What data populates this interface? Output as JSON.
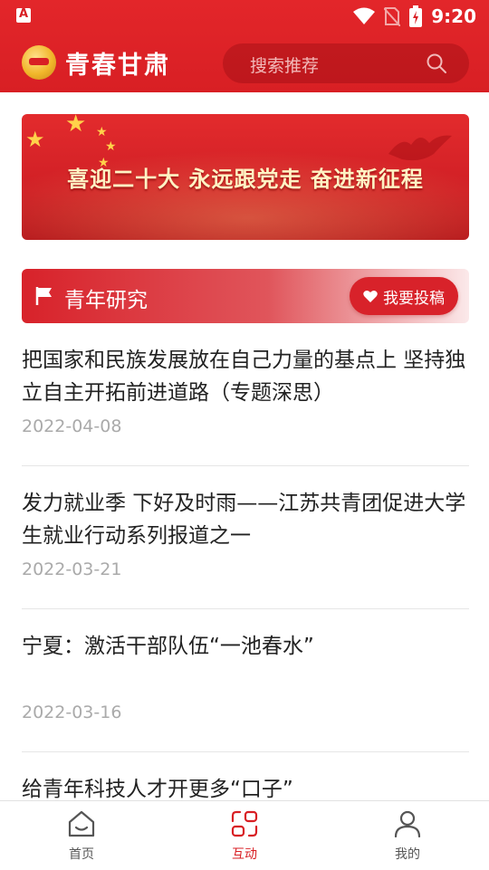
{
  "status_bar": {
    "time": "9:20"
  },
  "header": {
    "app_title": "青春甘肃",
    "search": {
      "placeholder": "搜索推荐"
    }
  },
  "banner": {
    "text": "喜迎二十大  永远跟党走  奋进新征程"
  },
  "section": {
    "title": "青年研究",
    "submit_label": "我要投稿"
  },
  "articles": [
    {
      "title": "把国家和民族发展放在自己力量的基点上 坚持独立自主开拓前进道路（专题深思）",
      "date": "2022-04-08"
    },
    {
      "title": "发力就业季 下好及时雨——江苏共青团促进大学生就业行动系列报道之一",
      "date": "2022-03-21"
    },
    {
      "title": "宁夏：激活干部队伍“一池春水”",
      "date": "2022-03-16"
    },
    {
      "title": "给青年科技人才开更多“口子”",
      "date": ""
    }
  ],
  "tabs": [
    {
      "label": "首页",
      "icon": "home-icon",
      "active": false
    },
    {
      "label": "互动",
      "icon": "interact-icon",
      "active": true
    },
    {
      "label": "我的",
      "icon": "person-icon",
      "active": false
    }
  ],
  "colors": {
    "brand_red": "#d81f24",
    "text_dark": "#222222",
    "text_gray": "#aaaaaa",
    "tab_inactive": "#555555"
  }
}
